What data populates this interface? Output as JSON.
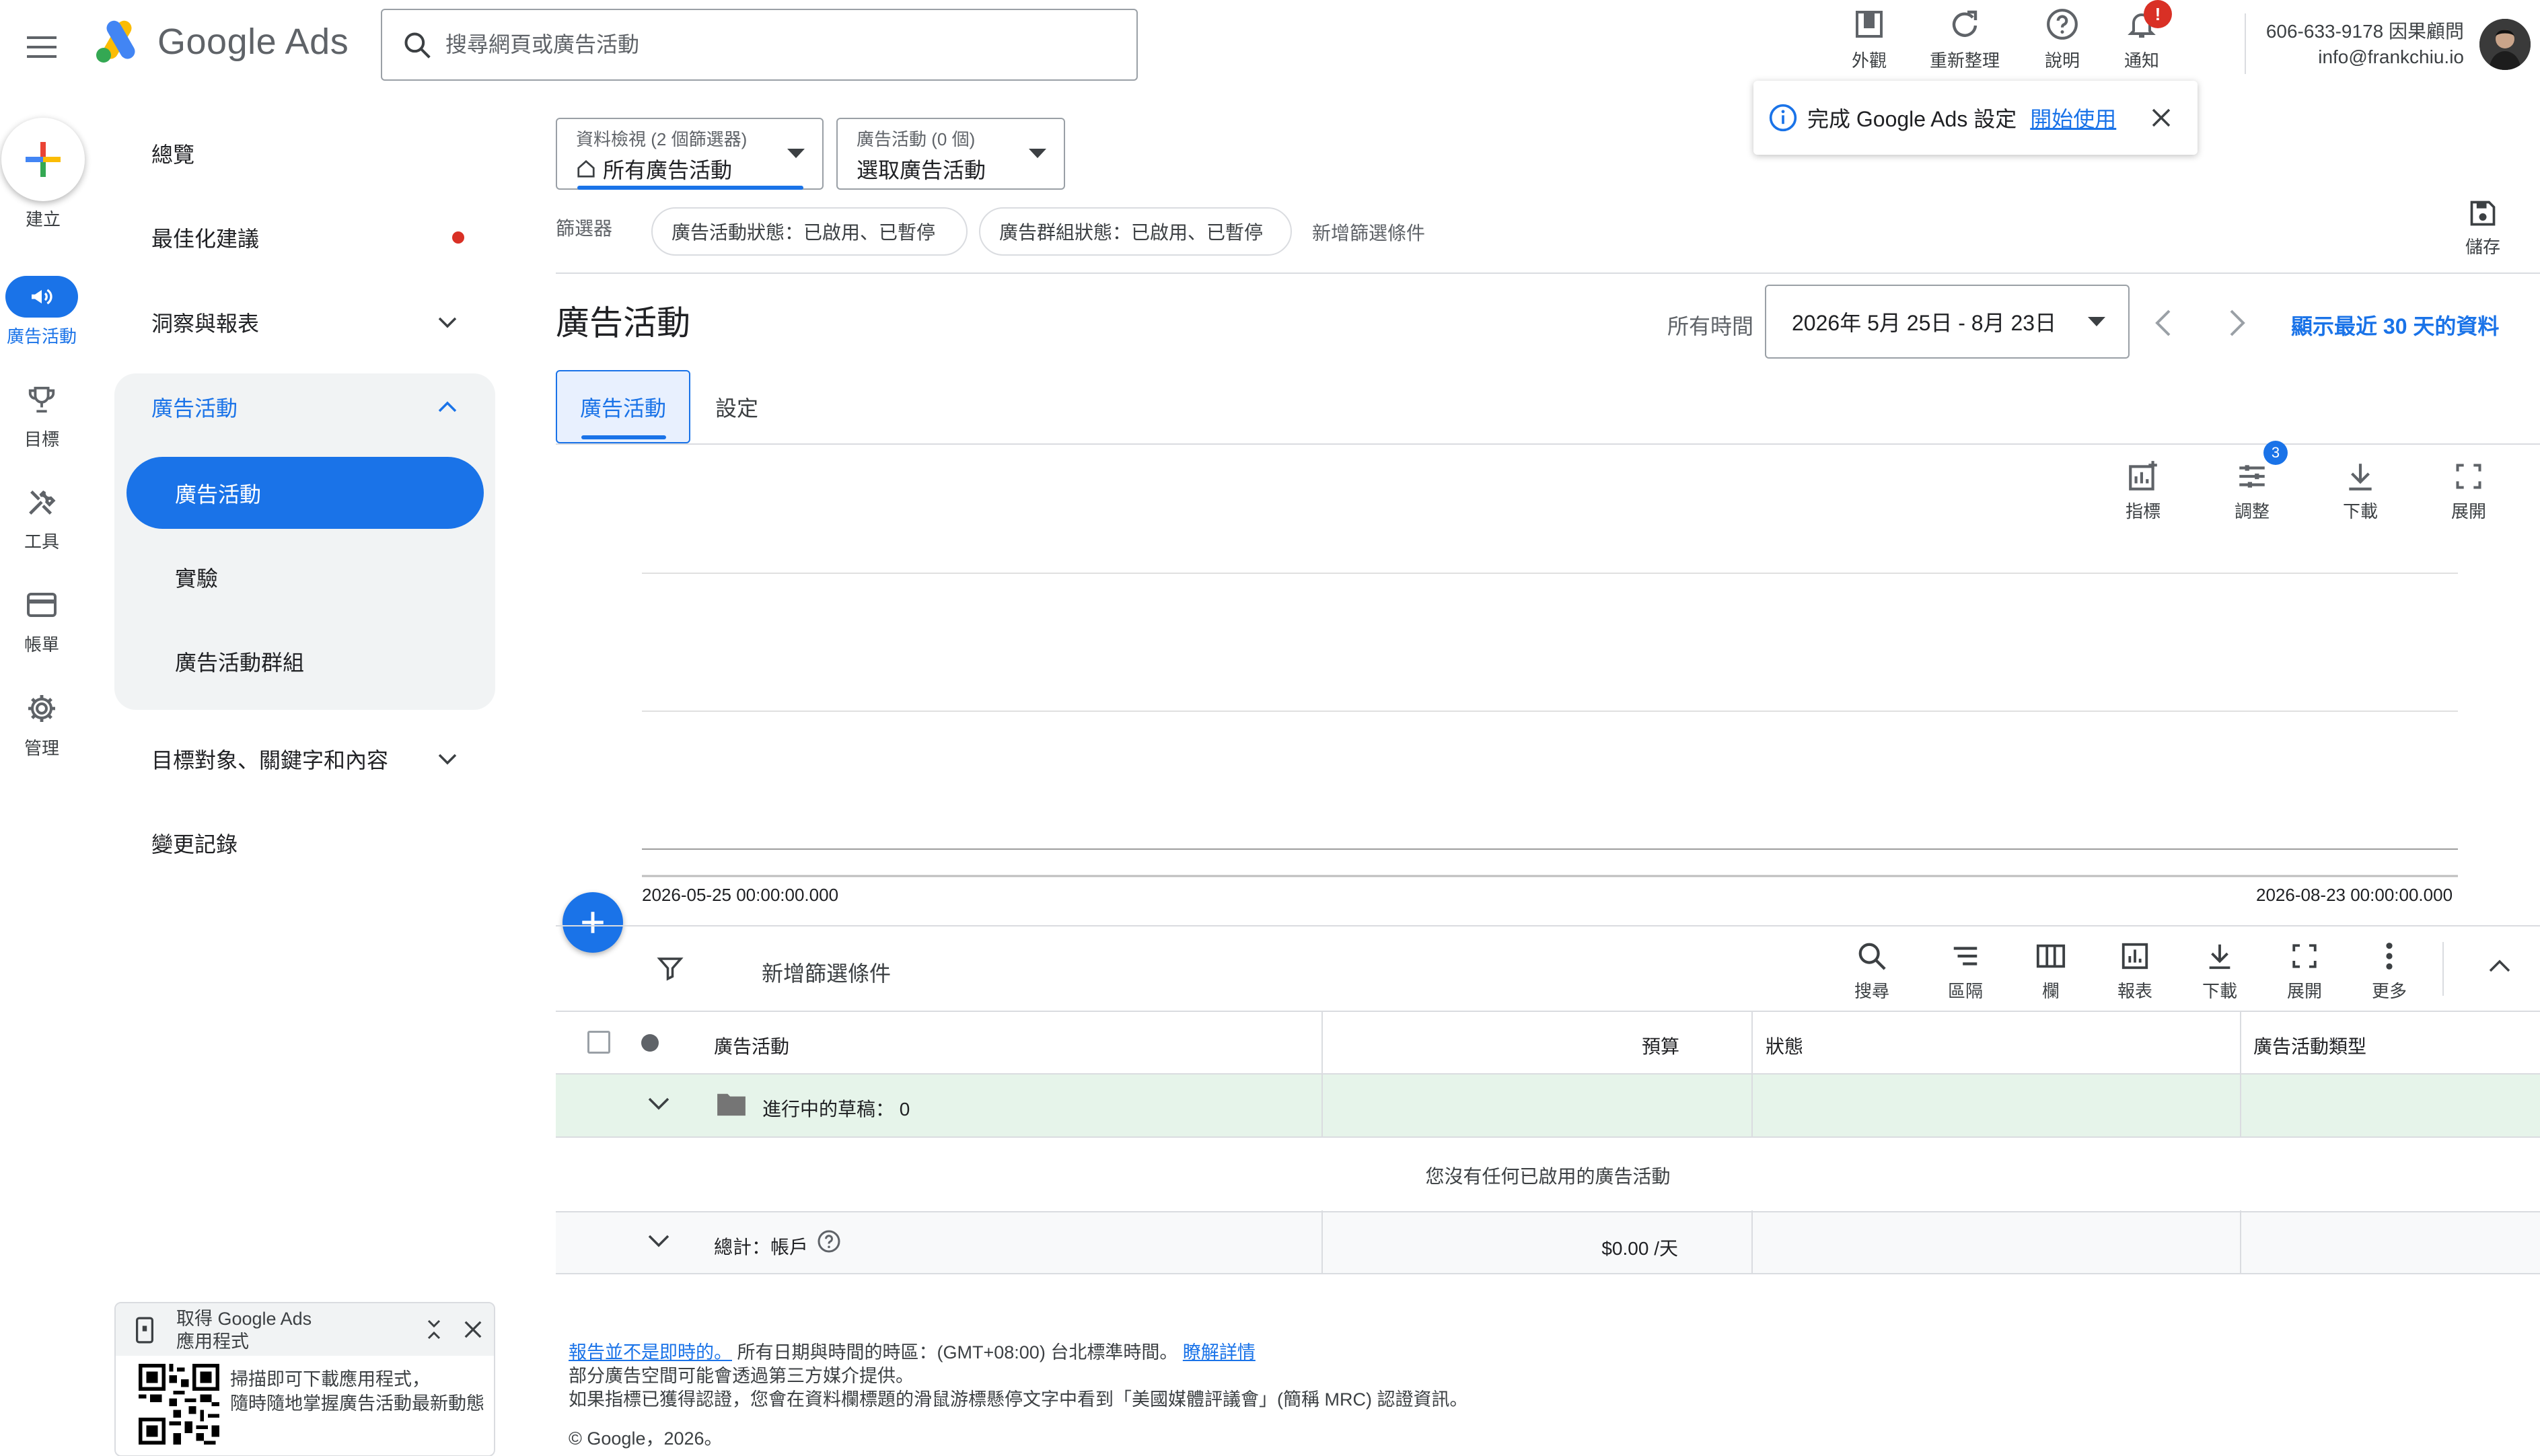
{
  "header": {
    "logo_text": "Google Ads",
    "search_placeholder": "搜尋網頁或廣告活動",
    "actions": [
      {
        "icon": "appearance-icon",
        "label": "外觀"
      },
      {
        "icon": "refresh-icon",
        "label": "重新整理"
      },
      {
        "icon": "help-icon",
        "label": "說明"
      },
      {
        "icon": "bell-icon",
        "label": "通知"
      }
    ],
    "notification_badge": "!",
    "account_line1": "606-633-9178 因果顧問",
    "account_line2": "info@frankchiu.io"
  },
  "rail": {
    "create_label": "建立",
    "items": [
      {
        "icon": "campaign-megaphone-icon",
        "label": "廣告活動",
        "active": true
      },
      {
        "icon": "trophy-icon",
        "label": "目標"
      },
      {
        "icon": "tools-icon",
        "label": "工具"
      },
      {
        "icon": "billing-card-icon",
        "label": "帳單"
      },
      {
        "icon": "gear-icon",
        "label": "管理"
      }
    ]
  },
  "nav": {
    "overview": "總覽",
    "recommendations": "最佳化建議",
    "insights": "洞察與報表",
    "campaigns_group": "廣告活動",
    "campaigns": "廣告活動",
    "experiments": "實驗",
    "campaign_groups": "廣告活動群組",
    "audiences": "目標對象、關鍵字和內容",
    "change_history": "變更記錄"
  },
  "toolbar": {
    "view_small": "資料檢視 (2 個篩選器)",
    "view_big": "所有廣告活動",
    "campaign_small": "廣告活動 (0 個)",
    "campaign_big": "選取廣告活動",
    "filter_label": "篩選器",
    "chips": [
      "廣告活動狀態：已啟用、已暫停",
      "廣告群組狀態：已啟用、已暫停"
    ],
    "add_filter": "新增篩選條件",
    "save_label": "儲存"
  },
  "toast": {
    "text": "完成 Google Ads 設定",
    "link": "開始使用"
  },
  "page": {
    "title": "廣告活動",
    "date_range_label": "所有時間",
    "date_range": "2026年 5月 25日 - 8月 23日",
    "show_recent": "顯示最近 30 天的資料",
    "tabs": [
      {
        "label": "廣告活動",
        "active": true
      },
      {
        "label": "設定"
      }
    ]
  },
  "chart_tools": [
    {
      "icon": "metrics-icon",
      "label": "指標"
    },
    {
      "icon": "adjust-icon",
      "label": "調整",
      "badge": "3"
    },
    {
      "icon": "download-icon",
      "label": "下載"
    },
    {
      "icon": "expand-icon",
      "label": "展開"
    }
  ],
  "chart_data": {
    "type": "line",
    "x_start": "2026-05-25 00:00:00.000",
    "x_end": "2026-08-23 00:00:00.000",
    "series": []
  },
  "table_tools": {
    "add_filter": "新增篩選條件",
    "items": [
      {
        "icon": "search-icon",
        "label": "搜尋"
      },
      {
        "icon": "segment-icon",
        "label": "區隔"
      },
      {
        "icon": "columns-icon",
        "label": "欄"
      },
      {
        "icon": "report-icon",
        "label": "報表"
      },
      {
        "icon": "download-icon",
        "label": "下載"
      },
      {
        "icon": "expand-icon",
        "label": "展開"
      },
      {
        "icon": "more-icon",
        "label": "更多"
      }
    ]
  },
  "table": {
    "headers": {
      "campaign": "廣告活動",
      "budget": "預算",
      "status": "狀態",
      "type": "廣告活動類型"
    },
    "draft_row": "進行中的草稿： 0",
    "empty_message": "您沒有任何已啟用的廣告活動",
    "total_label": "總計：帳戶",
    "total_budget": "$0.00 /天"
  },
  "footer": {
    "link1": "報告並不是即時的。",
    "line1": "所有日期與時間的時區：(GMT+08:00) 台北標準時間。",
    "link2": "瞭解詳情",
    "line2": "部分廣告空間可能會透過第三方媒介提供。",
    "line3": "如果指標已獲得認證，您會在資料欄標題的滑鼠游標懸停文字中看到「美國媒體評議會」(簡稱 MRC) 認證資訊。",
    "copyright": "© Google，2026。"
  },
  "app_promo": {
    "title_line1": "取得 Google Ads",
    "title_line2": "應用程式",
    "body_line1": "掃描即可下載應用程式，",
    "body_line2": "隨時隨地掌握廣告活動最新動態"
  }
}
